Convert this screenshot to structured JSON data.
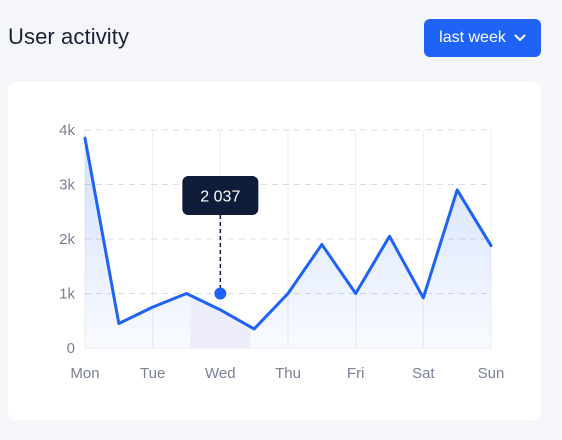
{
  "header": {
    "title": "User activity",
    "range_label": "last week"
  },
  "colors": {
    "accent": "#1e63f5",
    "tooltip_bg": "#0f1d3a",
    "highlight_band": "#ededfb"
  },
  "chart_data": {
    "type": "area",
    "categories": [
      "Mon",
      "Tue",
      "Wed",
      "Thu",
      "Fri",
      "Sat",
      "Sun"
    ],
    "x": [
      0,
      1,
      2,
      3,
      4,
      5,
      6,
      7,
      8,
      9,
      10,
      11,
      12
    ],
    "values": [
      3850,
      450,
      750,
      1000,
      700,
      350,
      1000,
      1900,
      1000,
      2050,
      920,
      2900,
      1880
    ],
    "yticks": [
      0,
      1000,
      2000,
      3000,
      4000
    ],
    "ytick_labels": [
      "0",
      "1k",
      "2k",
      "3k",
      "4k"
    ],
    "ylim": [
      0,
      4000
    ],
    "xlim": [
      0,
      12
    ],
    "grid": true,
    "highlight": {
      "category": "Wed",
      "value": 1000,
      "label": "2 037"
    }
  }
}
